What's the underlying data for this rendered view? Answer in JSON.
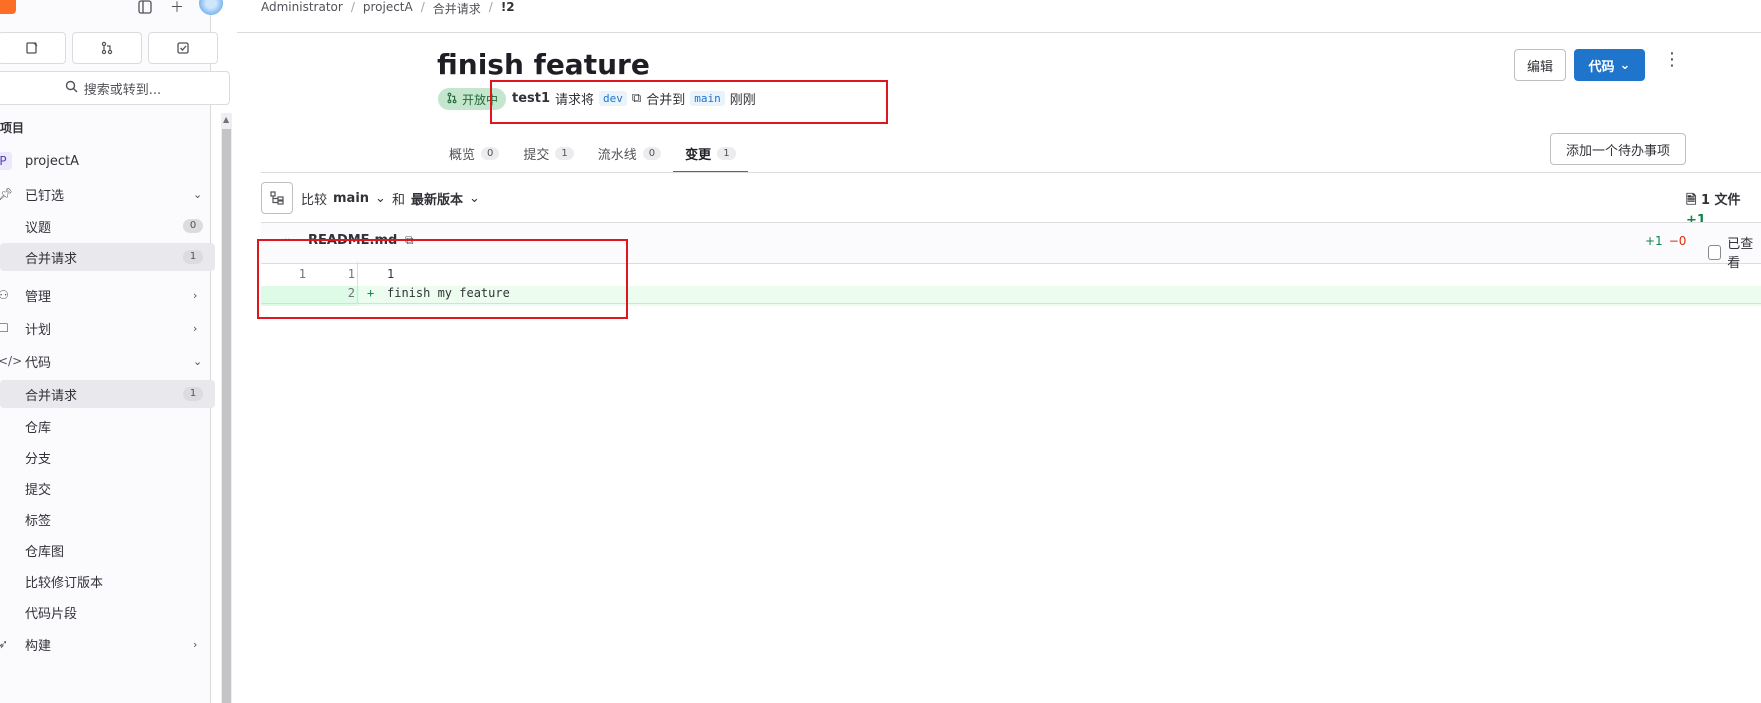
{
  "sidebar": {
    "search_label": "搜索或转到...",
    "section_title": "项目",
    "project_name": "projectA",
    "project_initial": "P",
    "items": [
      {
        "label": "已钉选",
        "type": "group"
      },
      {
        "label": "议题",
        "count": "0"
      },
      {
        "label": "合并请求",
        "count": "1"
      },
      {
        "label": "管理",
        "type": "group"
      },
      {
        "label": "计划",
        "type": "group"
      },
      {
        "label": "代码",
        "type": "group"
      },
      {
        "label": "合并请求",
        "count": "1"
      },
      {
        "label": "仓库"
      },
      {
        "label": "分支"
      },
      {
        "label": "提交"
      },
      {
        "label": "标签"
      },
      {
        "label": "仓库图"
      },
      {
        "label": "比较修订版本"
      },
      {
        "label": "代码片段"
      },
      {
        "label": "构建",
        "type": "group"
      }
    ]
  },
  "breadcrumb": [
    "Administrator",
    "projectA",
    "合并请求",
    "!2"
  ],
  "mr": {
    "title": "finish feature",
    "status": "开放中",
    "author": "test1",
    "request_text": "请求将",
    "source_branch": "dev",
    "merge_text": "合并到",
    "target_branch": "main",
    "time": "刚刚"
  },
  "buttons": {
    "edit": "编辑",
    "code": "代码",
    "add_todo": "添加一个待办事项"
  },
  "tabs": [
    {
      "label": "概览",
      "count": "0"
    },
    {
      "label": "提交",
      "count": "1"
    },
    {
      "label": "流水线",
      "count": "0"
    },
    {
      "label": "变更",
      "count": "1"
    }
  ],
  "compare": {
    "prefix": "比较",
    "base": "main",
    "and": "和",
    "head": "最新版本"
  },
  "file_summary": {
    "files": "1 文件",
    "added": "+1"
  },
  "file": {
    "name": "README.md",
    "additions": "+1",
    "deletions": "−0",
    "viewed_label": "已查看"
  },
  "diff_lines": [
    {
      "old": "1",
      "new": "1",
      "sign": "",
      "code": "1"
    },
    {
      "old": "",
      "new": "2",
      "sign": "+",
      "code": "finish my feature"
    }
  ],
  "colors": {
    "accent": "#1f75cb",
    "status_bg": "#c3e6cd",
    "annotation": "#e0161e"
  }
}
